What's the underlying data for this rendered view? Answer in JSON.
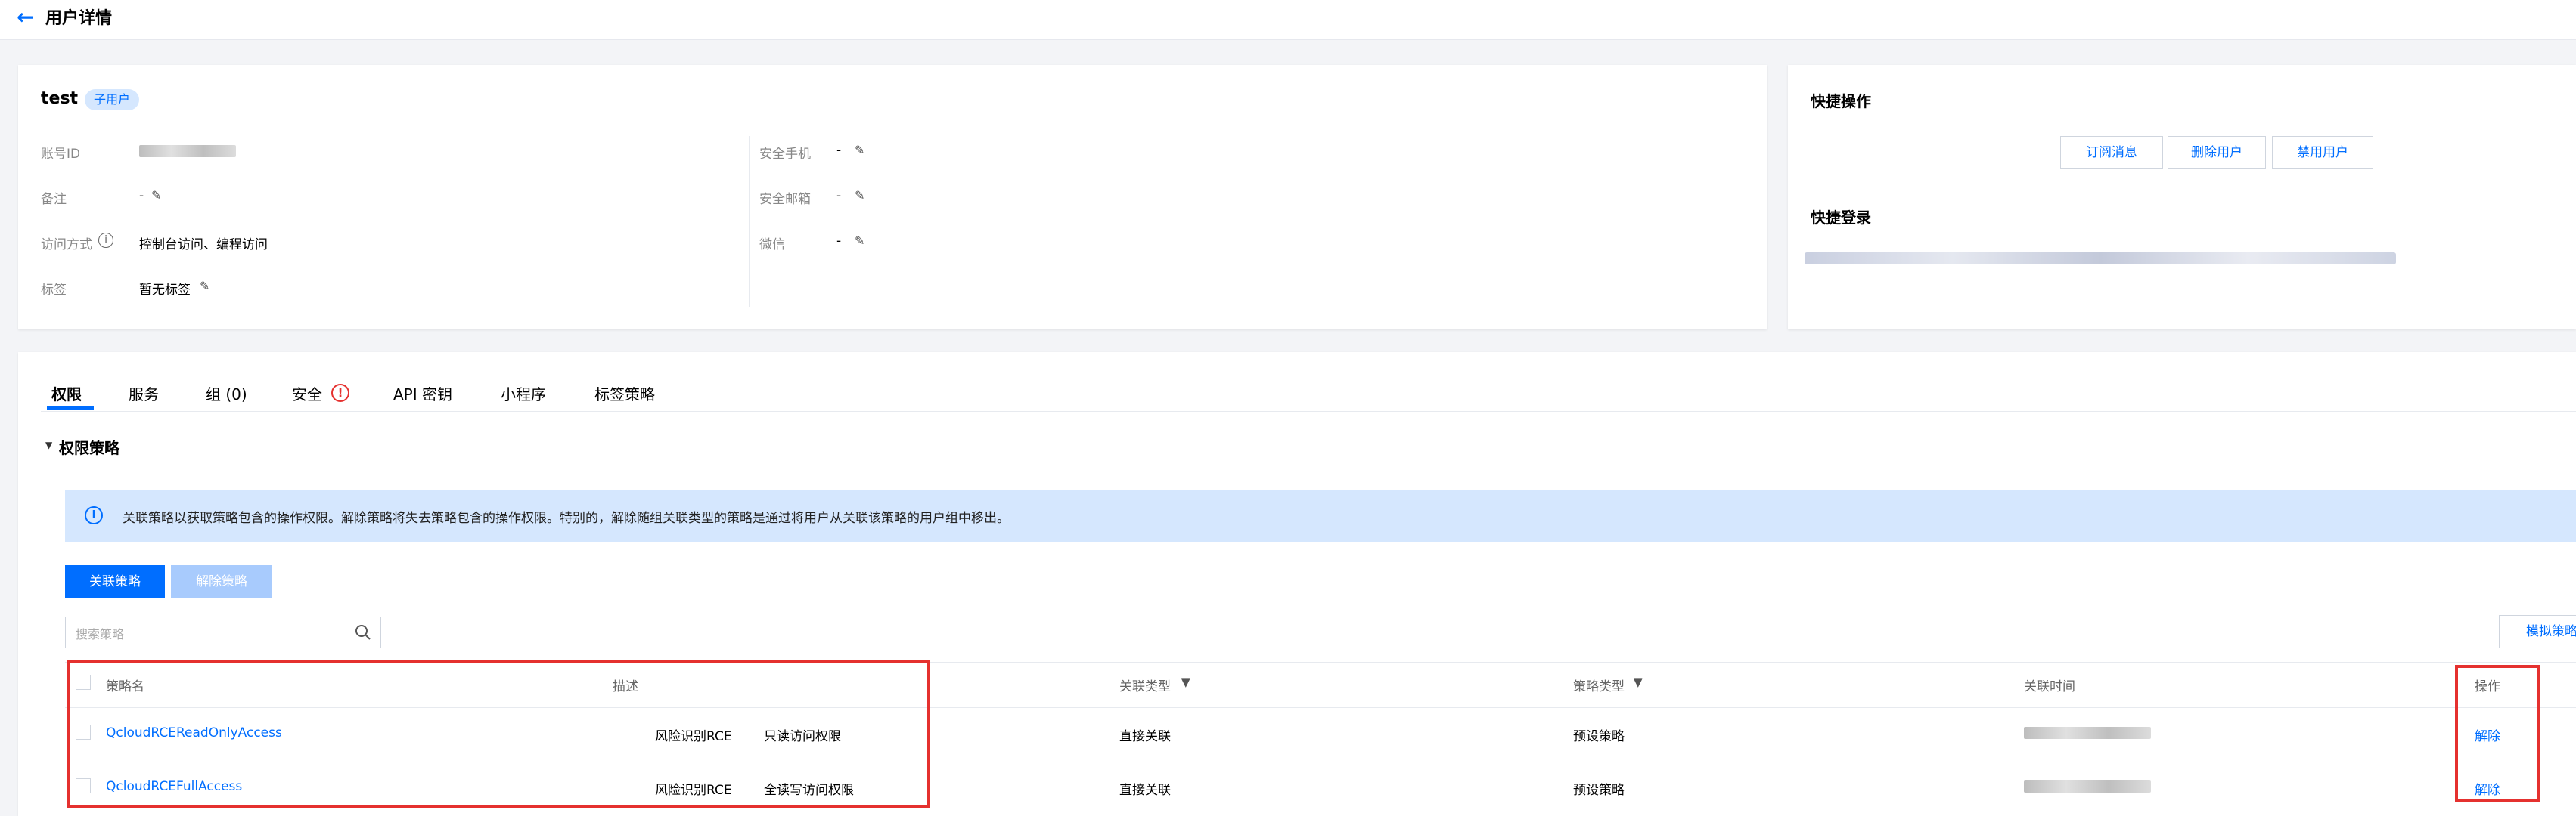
{
  "header": {
    "title": "用户详情"
  },
  "user": {
    "name": "test",
    "badge": "子用户",
    "fields_left": [
      {
        "label": "账号ID",
        "value": "",
        "editable": false
      },
      {
        "label": "备注",
        "value": "-",
        "editable": true
      },
      {
        "label": "访问方式",
        "value": "控制台访问、编程访问",
        "editable": false,
        "info": true
      },
      {
        "label": "标签",
        "value": "暂无标签",
        "editable": true
      }
    ],
    "fields_right": [
      {
        "label": "安全手机",
        "value": "-",
        "editable": true
      },
      {
        "label": "安全邮箱",
        "value": "-",
        "editable": true
      },
      {
        "label": "微信",
        "value": "-",
        "editable": true
      }
    ]
  },
  "quick": {
    "ops_title": "快捷操作",
    "buttons": [
      "订阅消息",
      "删除用户",
      "禁用用户"
    ],
    "login_title": "快捷登录"
  },
  "tabs": [
    "权限",
    "服务",
    "组 (0)",
    "安全",
    "API 密钥",
    "小程序",
    "标签策略"
  ],
  "section": {
    "title": "权限策略",
    "notice": "关联策略以获取策略包含的操作权限。解除策略将失去策略包含的操作权限。特别的，解除随组关联类型的策略是通过将用户从关联该策略的用户组中移出。",
    "attach_button": "关联策略",
    "detach_button": "解除策略",
    "search_placeholder": "搜索策略",
    "simulate_button": "模拟策略"
  },
  "table": {
    "headers": [
      "策略名",
      "描述",
      "关联类型",
      "策略类型",
      "关联时间",
      "操作"
    ],
    "rows": [
      {
        "name": "QcloudRCEReadOnlyAccess",
        "desc_a": "风险识别RCE",
        "desc_b": "只读访问权限",
        "assoc": "直接关联",
        "type": "预设策略",
        "time": "",
        "action": "解除"
      },
      {
        "name": "QcloudRCEFullAccess",
        "desc_a": "风险识别RCE",
        "desc_b": "全读写访问权限",
        "assoc": "直接关联",
        "type": "预设策略",
        "time": "",
        "action": "解除"
      }
    ]
  },
  "colors": {
    "accent": "#006eff",
    "highlight": "#e5312f",
    "notice_bg": "#d5e7fe"
  }
}
